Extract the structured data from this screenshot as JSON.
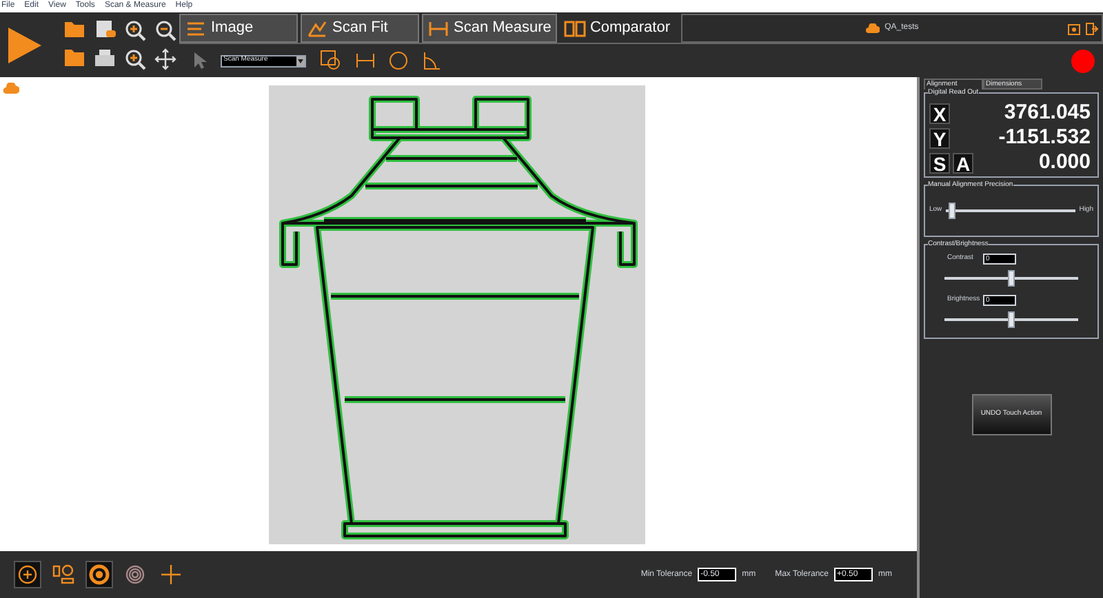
{
  "menu": [
    "File",
    "Edit",
    "View",
    "Tools",
    "Scan & Measure",
    "Help"
  ],
  "tabs": [
    {
      "label": "Image",
      "selected": false
    },
    {
      "label": "Scan Fit",
      "selected": false
    },
    {
      "label": "Scan Measure",
      "selected": false
    },
    {
      "label": "Comparator",
      "selected": true
    }
  ],
  "project": {
    "name": "QA_tests"
  },
  "measure_toolbar": {
    "mode": "Scan Measure"
  },
  "panel": {
    "tabs": [
      {
        "label": "Alignment",
        "selected": true
      },
      {
        "label": "Dimensions",
        "selected": false
      }
    ],
    "readout": {
      "title": "Digital Read Out",
      "rows": [
        {
          "keys": [
            "X"
          ],
          "value": "3761.045"
        },
        {
          "keys": [
            "Y"
          ],
          "value": "-1151.532"
        },
        {
          "keys": [
            "S",
            "A"
          ],
          "value": "0.000"
        }
      ]
    },
    "precision": {
      "title": "Manual Alignment Precision",
      "low": "Low",
      "high": "High",
      "level": 0.02
    },
    "contrast_brightness": {
      "title": "Contrast/Brightness",
      "sliders": [
        {
          "label": "Contrast",
          "value": "0",
          "level": 0.5
        },
        {
          "label": "Brightness",
          "value": "0",
          "level": 0.5
        }
      ]
    },
    "undo_button": "UNDO Touch Action"
  },
  "bottom_tools": [
    {
      "kind": "add",
      "selected": true
    },
    {
      "kind": "shapes",
      "selected": false
    },
    {
      "kind": "target",
      "selected": true
    },
    {
      "kind": "rings",
      "selected": false
    },
    {
      "kind": "cross",
      "selected": false
    }
  ],
  "tolerance": [
    {
      "label": "Min Tolerance",
      "value": "-0.50",
      "unit": "mm"
    },
    {
      "label": "Max Tolerance",
      "value": "+0.50",
      "unit": "mm"
    }
  ]
}
